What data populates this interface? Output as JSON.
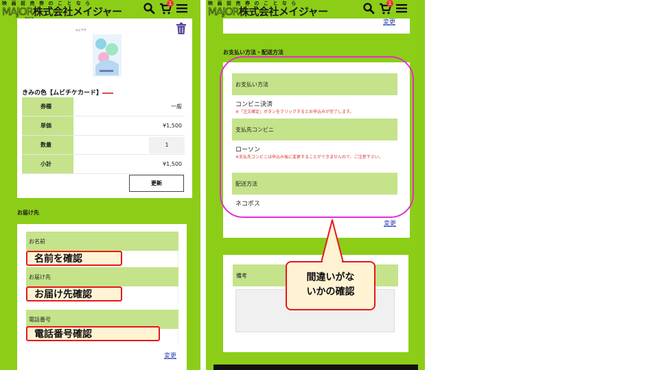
{
  "header": {
    "logo_kana": "映画前売券のことなら",
    "logo_en": "MAJOR",
    "logo_jp": "株式会社メイジャー",
    "cart_count": "1",
    "logo_sub": "MAJOR"
  },
  "cart": {
    "ticket_type_small": "ムビチケ",
    "item_name": "きみの色【ムビチケカード】",
    "rows": [
      {
        "label": "券種",
        "value": "一般"
      },
      {
        "label": "単価",
        "value": "¥1,500"
      },
      {
        "label": "数量",
        "value": "1"
      },
      {
        "label": "小計",
        "value": "¥1,500"
      }
    ],
    "update_label": "更新"
  },
  "delivery": {
    "section_title": "お届け先",
    "fields": [
      {
        "label": "お名前"
      },
      {
        "label": "お届け先"
      },
      {
        "label": "電話番号"
      }
    ],
    "change_label": "変更"
  },
  "annotations": {
    "name_check": "名前を確認",
    "address_check": "お届け先確認",
    "phone_check": "電話番号確認",
    "bubble_line1": "間違いがな",
    "bubble_line2": "いかの確認"
  },
  "payment": {
    "top_change_label": "変更",
    "section_title": "お支払い方法・配送方法",
    "method_label": "お支払い方法",
    "method_value": "コンビニ決済",
    "method_note": "※「注文確定」ボタンをクリックするとお申込みが完了します。",
    "store_label": "支払先コンビニ",
    "store_value": "ローソン",
    "store_note": "※支払先コンビニは申込み後に変更することができませんので、ご注意下さい。",
    "shipping_label": "配送方法",
    "shipping_value": "ネコポス",
    "change_label": "変更"
  },
  "remarks": {
    "label": "備考"
  },
  "colors": {
    "brand_green": "#8ccd18",
    "label_green": "#c4e38a",
    "highlight_red": "#e5161c",
    "highlight_fill": "#fff3d4",
    "ellipse_magenta": "#e62ad3",
    "link_blue": "#2b46b5"
  }
}
